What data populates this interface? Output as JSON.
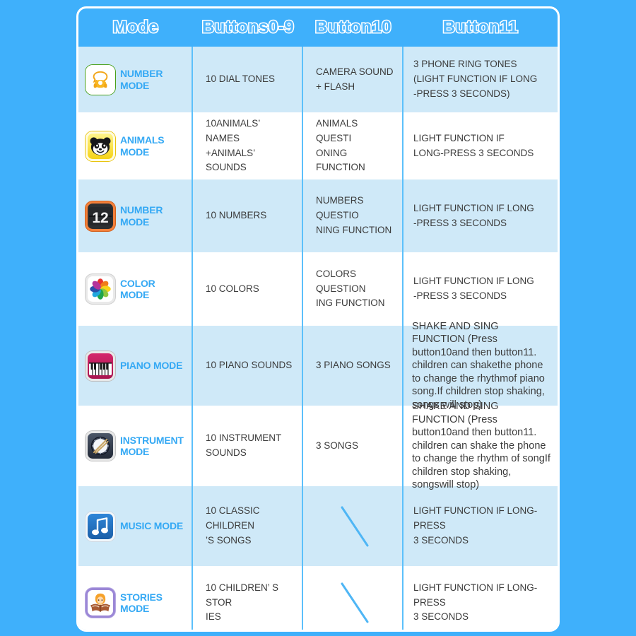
{
  "background_color": "#3fb0fb",
  "accent_color": "#35a9f4",
  "row_blue": "#cfe9f8",
  "row_white": "#ffffff",
  "divider_color": "#5cc0fb",
  "header": {
    "columns": [
      {
        "label": "Mode",
        "key": "mode"
      },
      {
        "label": "Buttons0-9",
        "key": "buttons09"
      },
      {
        "label": "Button10",
        "key": "button10"
      },
      {
        "label": "Button11",
        "key": "button11"
      }
    ]
  },
  "rows": [
    {
      "icon": "phone-icon",
      "mode": "NUMBER MODE",
      "buttons09": "10 DIAL TONES",
      "button10": "CAMERA SOUND\n+ FLASH",
      "button11": "3 PHONE RING TONES\n(LIGHT FUNCTION IF LONG\n-PRESS 3 SECONDS)"
    },
    {
      "icon": "panda-icon",
      "mode": "ANIMALS MODE",
      "buttons09": "10ANIMALS’ NAMES\n+ANIMALS’ SOUNDS",
      "button10": "ANIMALS QUESTI\nONING FUNCTION",
      "button11": "LIGHT FUNCTION IF\nLONG-PRESS 3 SECONDS"
    },
    {
      "icon": "flip-clock-12-icon",
      "mode": "NUMBER MODE",
      "buttons09": "10 NUMBERS",
      "button10": "NUMBERS QUESTIO\nNING FUNCTION",
      "button11": "LIGHT FUNCTION IF LONG\n-PRESS 3 SECONDS"
    },
    {
      "icon": "color-wheel-icon",
      "mode": "COLOR MODE",
      "buttons09": "10 COLORS",
      "button10": "COLORS QUESTION\nING FUNCTION",
      "button11": "LIGHT FUNCTION IF LONG\n-PRESS 3 SECONDS"
    },
    {
      "icon": "piano-icon",
      "mode": "PIANO MODE",
      "buttons09": "10 PIANO SOUNDS",
      "button10": "3 PIANO SONGS",
      "button11": "SHAKE AND SING FUNCTION (Press button10and then button11. children can shakethe phone to change the rhythmof piano song.If children stop shaking, songs will stop)"
    },
    {
      "icon": "drum-icon",
      "mode": "INSTRUMENT MODE",
      "buttons09": "10 INSTRUMENT\nSOUNDS",
      "button10": "3 SONGS",
      "button11": "SHAKE AND SING FUNCTION (Press button10and then button11. children can shake the phone to change the rhythm of songIf children stop shaking, songswill stop)"
    },
    {
      "icon": "music-note-icon",
      "mode": "MUSIC MODE",
      "buttons09": "10 CLASSIC CHILDREN\n’S SONGS",
      "button10": "",
      "button10_slash": true,
      "button11": "LIGHT FUNCTION IF LONG-PRESS\n3 SECONDS"
    },
    {
      "icon": "story-book-icon",
      "mode": "STORIES MODE",
      "buttons09": "10 CHILDREN’ S STOR\nIES",
      "button10": "",
      "button10_slash": true,
      "button11": "LIGHT FUNCTION IF LONG-PRESS\n 3 SECONDS"
    }
  ]
}
